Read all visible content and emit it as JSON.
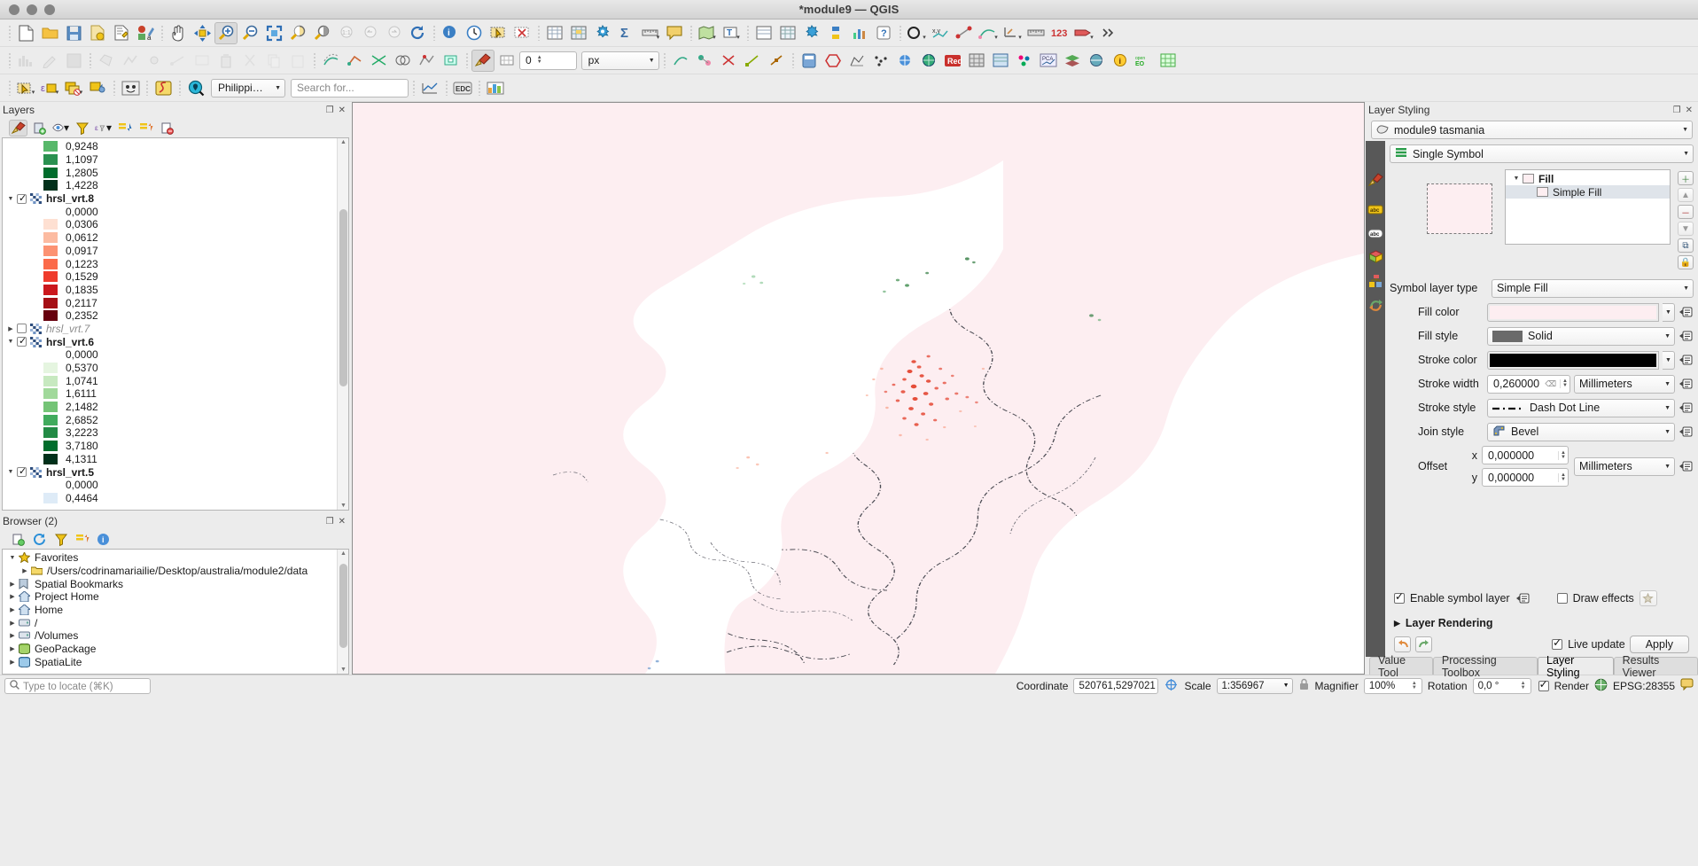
{
  "window": {
    "title": "*module9 — QGIS"
  },
  "toolbars": {
    "row1": [
      {
        "name": "new-project-icon",
        "glyph": "🗋"
      },
      {
        "name": "open-project-icon",
        "glyph": "📂"
      },
      {
        "name": "save-project-icon",
        "glyph": "💾"
      },
      {
        "name": "save-project-as-icon",
        "glyph": "🗂"
      },
      {
        "name": "new-print-layout-icon",
        "glyph": "🖺"
      },
      {
        "name": "style-manager-icon",
        "glyph": "🎨"
      },
      {
        "name": "pan-map-icon",
        "glyph": "✋"
      },
      {
        "name": "pan-to-selection-icon",
        "glyph": "✥"
      },
      {
        "name": "zoom-in-icon",
        "glyph": "🔍"
      },
      {
        "name": "zoom-out-icon",
        "glyph": "🔍"
      },
      {
        "name": "zoom-full-icon",
        "glyph": "⤢"
      },
      {
        "name": "zoom-to-selection-icon",
        "glyph": "◐"
      },
      {
        "name": "zoom-to-layer-icon",
        "glyph": "◑"
      },
      {
        "name": "zoom-native-resolution-icon",
        "glyph": "1:1"
      },
      {
        "name": "zoom-last-icon",
        "glyph": "↩"
      },
      {
        "name": "zoom-next-icon",
        "glyph": "↪"
      },
      {
        "name": "refresh-icon",
        "glyph": "⟳"
      },
      {
        "name": "identify-features-icon",
        "glyph": "ⓘ"
      },
      {
        "name": "temporal-controller-icon",
        "glyph": "🕐"
      },
      {
        "name": "statistical-summary-icon",
        "glyph": "Σ"
      },
      {
        "name": "measure-line-icon",
        "glyph": "📏"
      },
      {
        "name": "show-map-tips-icon",
        "glyph": "💬"
      },
      {
        "name": "new-map-view-icon",
        "glyph": "🗺"
      },
      {
        "name": "open-attribute-table-icon",
        "glyph": "▦"
      },
      {
        "name": "open-field-calculator-icon",
        "glyph": "▩"
      },
      {
        "name": "processing-toolbox-icon",
        "glyph": "⚙"
      },
      {
        "name": "sum-icon",
        "glyph": "Σ"
      },
      {
        "name": "measure-icon",
        "glyph": "📐"
      },
      {
        "name": "annotation-icon",
        "glyph": "🏷"
      },
      {
        "name": "select-features-icon",
        "glyph": "⬚"
      },
      {
        "name": "deselect-icon",
        "glyph": "⬛"
      },
      {
        "name": "text-annotation-icon",
        "glyph": "T"
      },
      {
        "name": "plugin-manager-icon",
        "glyph": "🧩"
      },
      {
        "name": "python-console-icon",
        "glyph": "🐍"
      },
      {
        "name": "help-icon",
        "glyph": "?"
      }
    ],
    "row2_dropdown_value": "0",
    "row2_units_value": "px",
    "search": {
      "placeholder": "Search for...",
      "value": ""
    },
    "locator_combo": "Philippines"
  },
  "layers_panel": {
    "title": "Layers",
    "toolbar_icons": [
      {
        "name": "open-layer-styling-panel-icon",
        "glyph": "🖌"
      },
      {
        "name": "add-group-icon",
        "glyph": "🗂"
      },
      {
        "name": "manage-map-themes-icon",
        "glyph": "👁"
      },
      {
        "name": "filter-legend-icon",
        "glyph": "▽"
      },
      {
        "name": "filter-legend-expression-icon",
        "glyph": "ε"
      },
      {
        "name": "expand-all-icon",
        "glyph": "⇊"
      },
      {
        "name": "collapse-all-icon",
        "glyph": "⇈"
      },
      {
        "name": "remove-layer-icon",
        "glyph": "▭"
      }
    ],
    "nodes": [
      {
        "type": "legend",
        "label": "0,9248",
        "color": "#57b86a"
      },
      {
        "type": "legend",
        "label": "1,1097",
        "color": "#2a9150"
      },
      {
        "type": "legend",
        "label": "1,2805",
        "color": "#006d2c"
      },
      {
        "type": "legend",
        "label": "1,4228",
        "color": "#01301a"
      },
      {
        "type": "layer",
        "label": "hrsl_vrt.8",
        "checked": true,
        "expanded": true,
        "visible": true
      },
      {
        "type": "legend",
        "label": "0,0000",
        "color": null
      },
      {
        "type": "legend",
        "label": "0,0306",
        "color": "#fee0d2"
      },
      {
        "type": "legend",
        "label": "0,0612",
        "color": "#fcbba1"
      },
      {
        "type": "legend",
        "label": "0,0917",
        "color": "#fc9272"
      },
      {
        "type": "legend",
        "label": "0,1223",
        "color": "#fb6a4a"
      },
      {
        "type": "legend",
        "label": "0,1529",
        "color": "#ef3b2c"
      },
      {
        "type": "legend",
        "label": "0,1835",
        "color": "#cb181d"
      },
      {
        "type": "legend",
        "label": "0,2117",
        "color": "#a50f15"
      },
      {
        "type": "legend",
        "label": "0,2352",
        "color": "#67000d"
      },
      {
        "type": "layer",
        "label": "hrsl_vrt.7",
        "checked": false,
        "expanded": false,
        "visible": false
      },
      {
        "type": "layer",
        "label": "hrsl_vrt.6",
        "checked": true,
        "expanded": true,
        "visible": true
      },
      {
        "type": "legend",
        "label": "0,0000",
        "color": null
      },
      {
        "type": "legend",
        "label": "0,5370",
        "color": "#e5f5e0"
      },
      {
        "type": "legend",
        "label": "1,0741",
        "color": "#c7e9c0"
      },
      {
        "type": "legend",
        "label": "1,6111",
        "color": "#a1d99b"
      },
      {
        "type": "legend",
        "label": "2,1482",
        "color": "#74c476"
      },
      {
        "type": "legend",
        "label": "2,6852",
        "color": "#41ab5d"
      },
      {
        "type": "legend",
        "label": "3,2223",
        "color": "#238b45"
      },
      {
        "type": "legend",
        "label": "3,7180",
        "color": "#006d2c"
      },
      {
        "type": "legend",
        "label": "4,1311",
        "color": "#01301a"
      },
      {
        "type": "layer",
        "label": "hrsl_vrt.5",
        "checked": true,
        "expanded": true,
        "visible": true
      },
      {
        "type": "legend",
        "label": "0,0000",
        "color": null
      },
      {
        "type": "legend",
        "label": "0,4464",
        "color": "#deebf7"
      }
    ]
  },
  "browser_panel": {
    "title": "Browser (2)",
    "toolbar_icons": [
      {
        "name": "add-selected-layers-icon",
        "glyph": "▭"
      },
      {
        "name": "refresh-browser-icon",
        "glyph": "⟳"
      },
      {
        "name": "filter-browser-icon",
        "glyph": "▽"
      },
      {
        "name": "collapse-all-browser-icon",
        "glyph": "⇈"
      },
      {
        "name": "browser-properties-icon",
        "glyph": "ⓘ"
      }
    ],
    "items": [
      {
        "label": "Favorites",
        "icon": "star-icon",
        "depth": 0,
        "expanded": true
      },
      {
        "label": "/Users/codrinamariailie/Desktop/australia/module2/data",
        "icon": "folder-icon",
        "depth": 1,
        "expanded": false
      },
      {
        "label": "Spatial Bookmarks",
        "icon": "bookmark-icon",
        "depth": 0,
        "expanded": false
      },
      {
        "label": "Project Home",
        "icon": "home-icon",
        "depth": 0,
        "expanded": false
      },
      {
        "label": "Home",
        "icon": "home-icon",
        "depth": 0,
        "expanded": false
      },
      {
        "label": "/",
        "icon": "drive-icon",
        "depth": 0,
        "expanded": false
      },
      {
        "label": "/Volumes",
        "icon": "drive-icon",
        "depth": 0,
        "expanded": false
      },
      {
        "label": "GeoPackage",
        "icon": "geopackage-icon",
        "depth": 0,
        "expanded": false
      },
      {
        "label": "SpatiaLite",
        "icon": "spatialite-icon",
        "depth": 0,
        "expanded": false
      }
    ]
  },
  "layer_styling": {
    "title": "Layer Styling",
    "layer_combo": "module9 tasmania",
    "renderer_combo": "Single Symbol",
    "side_tabs": [
      {
        "name": "symbology-tab-icon",
        "glyph": "🖌"
      },
      {
        "name": "labels-tab-icon",
        "glyph": "abc"
      },
      {
        "name": "masks-tab-icon",
        "glyph": "abc"
      },
      {
        "name": "3d-view-tab-icon",
        "glyph": "◆"
      },
      {
        "name": "diagrams-tab-icon",
        "glyph": "▦"
      },
      {
        "name": "history-tab-icon",
        "glyph": "↺"
      }
    ],
    "symbol_tree": [
      {
        "label": "Fill",
        "level": 0,
        "selected": false
      },
      {
        "label": "Simple Fill",
        "level": 1,
        "selected": true
      }
    ],
    "symbol_side_buttons": [
      {
        "name": "add-symbol-layer-button",
        "glyph": "＋"
      },
      {
        "name": "move-symbol-layer-up-button",
        "glyph": "▲"
      },
      {
        "name": "remove-symbol-layer-button",
        "glyph": "－"
      },
      {
        "name": "move-symbol-layer-down-button",
        "glyph": "▼"
      },
      {
        "name": "duplicate-symbol-layer-button",
        "glyph": "⧉"
      },
      {
        "name": "lock-symbol-layer-button",
        "glyph": "🔒"
      }
    ],
    "fields": {
      "symbol_layer_type_label": "Symbol layer type",
      "symbol_layer_type_value": "Simple Fill",
      "fill_color_label": "Fill color",
      "fill_color_value": "#fdeef1",
      "fill_style_label": "Fill style",
      "fill_style_value": "Solid",
      "stroke_color_label": "Stroke color",
      "stroke_color_value": "#000000",
      "stroke_width_label": "Stroke width",
      "stroke_width_value": "0,260000",
      "stroke_width_units": "Millimeters",
      "stroke_style_label": "Stroke style",
      "stroke_style_value": "Dash Dot Line",
      "join_style_label": "Join style",
      "join_style_value": "Bevel",
      "offset_label": "Offset",
      "offset_x_label": "x",
      "offset_x_value": "0,000000",
      "offset_y_label": "y",
      "offset_y_value": "0,000000",
      "offset_units": "Millimeters"
    },
    "enable_symbol_layer_label": "Enable symbol layer",
    "enable_symbol_layer_checked": true,
    "draw_effects_label": "Draw effects",
    "draw_effects_checked": false,
    "layer_rendering_label": "Layer Rendering",
    "live_update_label": "Live update",
    "live_update_checked": true,
    "apply_label": "Apply"
  },
  "dock_tabs": [
    {
      "label": "Value Tool",
      "selected": false
    },
    {
      "label": "Processing Toolbox",
      "selected": false
    },
    {
      "label": "Layer Styling",
      "selected": true
    },
    {
      "label": "Results Viewer",
      "selected": false
    }
  ],
  "statusbar": {
    "locate_placeholder": "Type to locate (⌘K)",
    "coordinate_label": "Coordinate",
    "coordinate_value": "520761,5297021",
    "scale_label": "Scale",
    "scale_value": "1:356967",
    "magnifier_label": "Magnifier",
    "magnifier_value": "100%",
    "rotation_label": "Rotation",
    "rotation_value": "0,0 °",
    "render_label": "Render",
    "render_checked": true,
    "crs_label": "EPSG:28355"
  }
}
